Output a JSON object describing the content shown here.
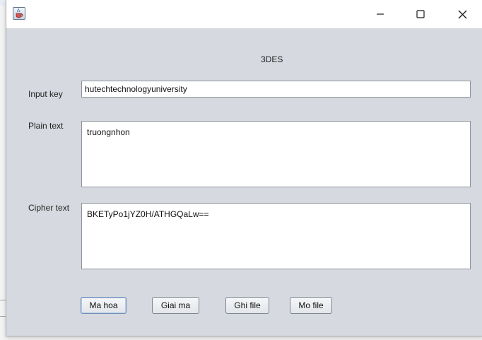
{
  "window": {
    "app_icon": "java-cup-icon",
    "controls": {
      "minimize_icon": "minimize-icon",
      "maximize_icon": "maximize-icon",
      "close_icon": "close-icon"
    }
  },
  "form": {
    "heading": "3DES",
    "key": {
      "label": "Input key",
      "value": "hutechtechnologyuniversity"
    },
    "plain": {
      "label": "Plain text",
      "value": "truongnhon"
    },
    "cipher": {
      "label": "Cipher text",
      "value": "BKETyPo1jYZ0H/ATHGQaLw=="
    }
  },
  "buttons": {
    "encrypt": "Ma hoa",
    "decrypt": "Giai ma",
    "write_file": "Ghi file",
    "open_file": "Mo file"
  },
  "colors": {
    "window_bg": "#d6d9df",
    "titlebar_bg": "#ffffff",
    "focus_border": "#6f8fb7"
  }
}
